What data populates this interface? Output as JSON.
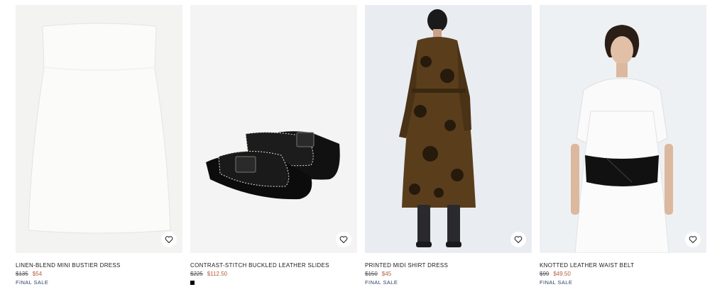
{
  "products": [
    {
      "name": "LINEN-BLEND MINI BUSTIER DRESS",
      "original_price": "$135",
      "sale_price": "$54",
      "label": "FINAL SALE",
      "image_icon": "white-bustier-dress"
    },
    {
      "name": "CONTRAST-STITCH BUCKLED LEATHER SLIDES",
      "original_price": "$225",
      "sale_price": "$112.50",
      "swatch_color": "#000000",
      "image_icon": "black-leather-slides"
    },
    {
      "name": "PRINTED MIDI SHIRT DRESS",
      "original_price": "$150",
      "sale_price": "$45",
      "label": "FINAL SALE",
      "image_icon": "printed-shirt-dress-model"
    },
    {
      "name": "KNOTTED LEATHER WAIST BELT",
      "original_price": "$99",
      "sale_price": "$49.50",
      "label": "FINAL SALE",
      "image_icon": "black-waist-belt-model"
    }
  ],
  "colors": {
    "sale_price": "#b45a3c",
    "final_sale": "#2e3f66",
    "image_bg_light": "#f3f3f2",
    "image_bg_studio": "#e9edf2"
  },
  "icons": {
    "wishlist": "heart-icon"
  }
}
